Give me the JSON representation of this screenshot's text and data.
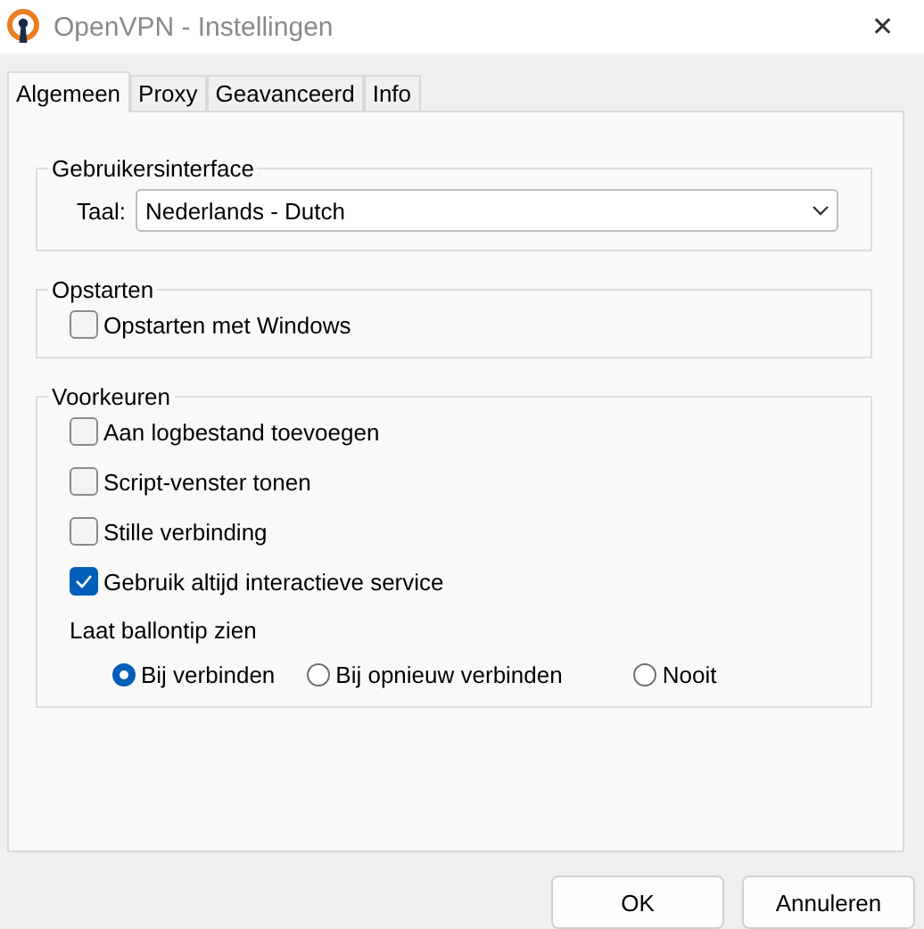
{
  "window": {
    "title": "OpenVPN - Instellingen",
    "close": "✕"
  },
  "tabs": [
    {
      "label": "Algemeen",
      "selected": true
    },
    {
      "label": "Proxy",
      "selected": false
    },
    {
      "label": "Geavanceerd",
      "selected": false
    },
    {
      "label": "Info",
      "selected": false
    }
  ],
  "groups": [
    {
      "title": "Gebruikersinterface",
      "items": [
        {
          "kind": "select",
          "label": "Taal:",
          "value": "Nederlands - Dutch"
        }
      ]
    },
    {
      "title": "Opstarten",
      "items": [
        {
          "kind": "checkbox",
          "label": "Opstarten met Windows",
          "checked": false
        }
      ]
    },
    {
      "title": "Voorkeuren",
      "items": [
        {
          "kind": "checkbox",
          "label": "Aan logbestand toevoegen",
          "checked": false
        },
        {
          "kind": "checkbox",
          "label": "Script-venster tonen",
          "checked": false
        },
        {
          "kind": "checkbox",
          "label": "Stille verbinding",
          "checked": false
        },
        {
          "kind": "checkbox",
          "label": "Gebruik altijd interactieve service",
          "checked": true
        },
        {
          "kind": "radios",
          "label": "Laat ballontip zien",
          "options": [
            {
              "label": "Bij verbinden",
              "selected": true
            },
            {
              "label": "Bij opnieuw verbinden",
              "selected": false
            },
            {
              "label": "Nooit",
              "selected": false
            }
          ]
        }
      ]
    }
  ],
  "buttons": [
    "OK",
    "Annuleren"
  ]
}
